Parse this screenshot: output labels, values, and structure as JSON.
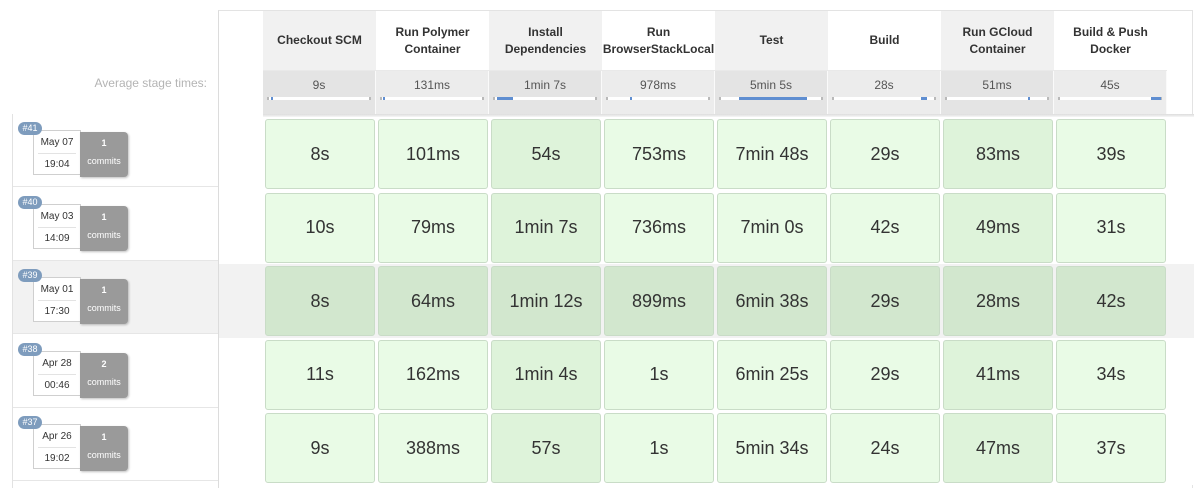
{
  "average_label": "Average stage times:",
  "stages": [
    {
      "name": "Checkout SCM",
      "avg": "9s",
      "bar": [
        0.02,
        0.04
      ]
    },
    {
      "name": "Run Polymer Container",
      "avg": "131ms",
      "bar": [
        0.01,
        0.03
      ]
    },
    {
      "name": "Install Dependencies",
      "avg": "1min 7s",
      "bar": [
        0.02,
        0.18
      ]
    },
    {
      "name": "Run BrowserStackLocal",
      "avg": "978ms",
      "bar": [
        0.22,
        0.24
      ]
    },
    {
      "name": "Test",
      "avg": "5min 5s",
      "bar": [
        0.18,
        0.85
      ]
    },
    {
      "name": "Build",
      "avg": "28s",
      "bar": [
        0.86,
        0.92
      ]
    },
    {
      "name": "Run GCloud Container",
      "avg": "51ms",
      "bar": [
        0.8,
        0.82
      ]
    },
    {
      "name": "Build & Push Docker",
      "avg": "45s",
      "bar": [
        0.9,
        1.0
      ]
    }
  ],
  "builds": [
    {
      "id": "#41",
      "date": "May 07",
      "time": "19:04",
      "commits": "1",
      "commits_label": "commits",
      "durations": [
        "8s",
        "101ms",
        "54s",
        "753ms",
        "7min 48s",
        "29s",
        "83ms",
        "39s"
      ]
    },
    {
      "id": "#40",
      "date": "May 03",
      "time": "14:09",
      "commits": "1",
      "commits_label": "commits",
      "durations": [
        "10s",
        "79ms",
        "1min 7s",
        "736ms",
        "7min 0s",
        "42s",
        "49ms",
        "31s"
      ]
    },
    {
      "id": "#39",
      "date": "May 01",
      "time": "17:30",
      "commits": "1",
      "commits_label": "commits",
      "durations": [
        "8s",
        "64ms",
        "1min 12s",
        "899ms",
        "6min 38s",
        "29s",
        "28ms",
        "42s"
      ]
    },
    {
      "id": "#38",
      "date": "Apr 28",
      "time": "00:46",
      "commits": "2",
      "commits_label": "commits",
      "durations": [
        "11s",
        "162ms",
        "1min 4s",
        "1s",
        "6min 25s",
        "29s",
        "41ms",
        "34s"
      ]
    },
    {
      "id": "#37",
      "date": "Apr 26",
      "time": "19:02",
      "commits": "1",
      "commits_label": "commits",
      "durations": [
        "9s",
        "388ms",
        "57s",
        "1s",
        "5min 34s",
        "24s",
        "47ms",
        "37s"
      ]
    }
  ],
  "highlighted_build_index": 2,
  "colors": {
    "success_cell": "#e9fbe6",
    "success_cell_border": "#c9dcc7",
    "badge": "#7e9cbd",
    "commits_box": "#9a9a9a",
    "avg_bar": "#5f8ed1"
  }
}
